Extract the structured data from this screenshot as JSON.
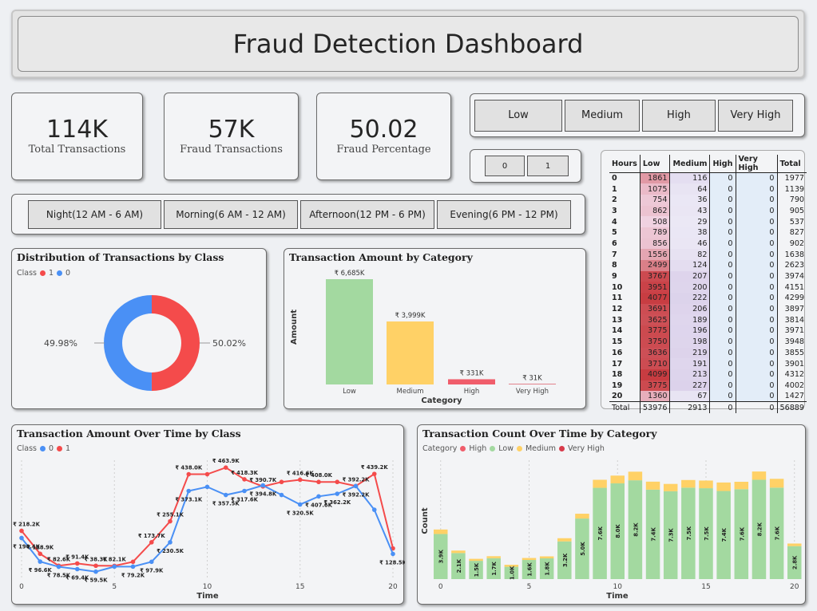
{
  "title": "Fraud Detection Dashboard",
  "kpis": [
    {
      "value": "114K",
      "label": "Total Transactions"
    },
    {
      "value": "57K",
      "label": "Fraud Transactions"
    },
    {
      "value": "50.02",
      "label": "Fraud Percentage"
    }
  ],
  "category_slicer": [
    "Low",
    "Medium",
    "High",
    "Very High"
  ],
  "class_slicer": [
    "0",
    "1"
  ],
  "time_slicer": [
    "Night(12 AM - 6 AM)",
    "Morning(6 AM - 12 AM)",
    "Afternoon(12 PM - 6 PM)",
    "Evening(6 PM - 12 PM)"
  ],
  "colors": {
    "class1": "#f44b4b",
    "class0": "#4a90f5",
    "low": "#a3d9a0",
    "medium": "#ffd166",
    "high": "#f05d6b",
    "very_high": "#d83a4a"
  },
  "donut": {
    "title": "Distribution of Transactions by Class",
    "legend_title": "Class",
    "legend": [
      "1",
      "0"
    ],
    "label_left": "49.98%",
    "label_right": "50.02%"
  },
  "bar_panel": {
    "title": "Transaction Amount by Category",
    "xlabel": "Category",
    "ylabel": "Amount"
  },
  "amount_panel": {
    "title": "Transaction Amount Over Time by Class",
    "legend_title": "Class",
    "legend": [
      "0",
      "1"
    ],
    "xlabel": "Time"
  },
  "count_panel": {
    "title": "Transaction Count Over Time by Category",
    "legend_title": "Category",
    "legend": [
      "High",
      "Low",
      "Medium",
      "Very High"
    ],
    "xlabel": "Time",
    "ylabel": "Count"
  },
  "matrix": {
    "headers": [
      "Hours",
      "Low",
      "Medium",
      "High",
      "Very High",
      "Total"
    ],
    "rows": [
      [
        "0",
        "1861",
        "116",
        "0",
        "0",
        "1977"
      ],
      [
        "1",
        "1075",
        "64",
        "0",
        "0",
        "1139"
      ],
      [
        "2",
        "754",
        "36",
        "0",
        "0",
        "790"
      ],
      [
        "3",
        "862",
        "43",
        "0",
        "0",
        "905"
      ],
      [
        "4",
        "508",
        "29",
        "0",
        "0",
        "537"
      ],
      [
        "5",
        "789",
        "38",
        "0",
        "0",
        "827"
      ],
      [
        "6",
        "856",
        "46",
        "0",
        "0",
        "902"
      ],
      [
        "7",
        "1556",
        "82",
        "0",
        "0",
        "1638"
      ],
      [
        "8",
        "2499",
        "124",
        "0",
        "0",
        "2623"
      ],
      [
        "9",
        "3767",
        "207",
        "0",
        "0",
        "3974"
      ],
      [
        "10",
        "3951",
        "200",
        "0",
        "0",
        "4151"
      ],
      [
        "11",
        "4077",
        "222",
        "0",
        "0",
        "4299"
      ],
      [
        "12",
        "3691",
        "206",
        "0",
        "0",
        "3897"
      ],
      [
        "13",
        "3625",
        "189",
        "0",
        "0",
        "3814"
      ],
      [
        "14",
        "3775",
        "196",
        "0",
        "0",
        "3971"
      ],
      [
        "15",
        "3750",
        "198",
        "0",
        "0",
        "3948"
      ],
      [
        "16",
        "3636",
        "219",
        "0",
        "0",
        "3855"
      ],
      [
        "17",
        "3710",
        "191",
        "0",
        "0",
        "3901"
      ],
      [
        "18",
        "4099",
        "213",
        "0",
        "0",
        "4312"
      ],
      [
        "19",
        "3775",
        "227",
        "0",
        "0",
        "4002"
      ],
      [
        "20",
        "1360",
        "67",
        "0",
        "0",
        "1427"
      ]
    ],
    "total": [
      "Total",
      "53976",
      "2913",
      "0",
      "0",
      "56889"
    ]
  },
  "chart_data": [
    {
      "type": "pie",
      "title": "Distribution of Transactions by Class",
      "categories": [
        "1",
        "0"
      ],
      "values": [
        50.02,
        49.98
      ],
      "data_labels": [
        "50.02%",
        "49.98%"
      ]
    },
    {
      "type": "bar",
      "title": "Transaction Amount by Category",
      "xlabel": "Category",
      "ylabel": "Amount",
      "categories": [
        "Low",
        "Medium",
        "High",
        "Very High"
      ],
      "values": [
        6685,
        3999,
        331,
        31
      ],
      "data_labels": [
        "₹ 6,685K",
        "₹ 3,999K",
        "₹ 331K",
        "₹ 31K"
      ]
    },
    {
      "type": "line",
      "title": "Transaction Amount Over Time by Class",
      "xlabel": "Time",
      "x_ticks": [
        "0",
        "5",
        "10",
        "15",
        "20"
      ],
      "x": [
        0,
        1,
        2,
        3,
        4,
        5,
        6,
        7,
        8,
        9,
        10,
        11,
        12,
        13,
        14,
        15,
        16,
        17,
        18,
        19,
        20
      ],
      "series": [
        {
          "name": "0",
          "values": [
            190.4,
            98.6,
            78.5,
            69.4,
            59.5,
            79.2,
            79.2,
            97.9,
            173.7,
            373.1,
            389.0,
            357.5,
            373.1,
            394.8,
            357.5,
            320.5,
            352.0,
            362.2,
            392.2,
            300.0,
            128.5
          ],
          "labels": [
            "₹ 190.4K",
            "₹ 96.6K",
            "₹ 78.5K",
            "₹ 69.4K",
            "₹ 59.5K",
            "",
            "₹ 79.2K",
            "₹ 97.9K",
            "₹ 230.5K",
            "₹ 373.1K",
            "",
            "₹ 357.5K",
            "₹ 317.6K",
            "₹ 394.8K",
            "",
            "₹ 320.5K",
            "₹ 407.6K",
            "₹ 362.2K",
            "₹ 392.2K",
            "",
            "₹ 128.5K"
          ]
        },
        {
          "name": "1",
          "values": [
            218.2,
            128.9,
            82.6,
            91.4,
            82.6,
            82.1,
            97.9,
            173.7,
            255.1,
            438.0,
            438.0,
            463.9,
            418.3,
            390.7,
            408.0,
            416.6,
            408.0,
            408.0,
            392.2,
            439.2,
            150.0
          ],
          "labels": [
            "₹ 218.2K",
            "₹ 128.9K",
            "₹ 82.6K",
            "₹ 91.4K",
            "₹ 38.3K",
            "₹ 82.1K",
            "",
            "₹ 173.7K",
            "₹ 255.1K",
            "₹ 438.0K",
            "",
            "₹ 463.9K",
            "₹ 418.3K",
            "₹ 390.7K",
            "",
            "₹ 416.6K",
            "₹ 408.0K",
            "",
            "₹ 392.2K",
            "₹ 439.2K",
            ""
          ]
        }
      ]
    },
    {
      "type": "bar",
      "stacked": true,
      "title": "Transaction Count Over Time by Category",
      "xlabel": "Time",
      "ylabel": "Count",
      "x_ticks": [
        "0",
        "5",
        "10",
        "15",
        "20"
      ],
      "x": [
        0,
        1,
        2,
        3,
        4,
        5,
        6,
        7,
        8,
        9,
        10,
        11,
        12,
        13,
        14,
        15,
        16,
        17,
        18,
        19,
        20
      ],
      "series": [
        {
          "name": "Low",
          "values": [
            1861,
            1075,
            754,
            862,
            508,
            789,
            856,
            1556,
            2499,
            3767,
            3951,
            4077,
            3691,
            3625,
            3775,
            3750,
            3636,
            3710,
            4099,
            3775,
            1360
          ],
          "labels": [
            "3.9K",
            "2.1K",
            "1.5K",
            "1.7K",
            "1.0K",
            "1.6K",
            "1.8K",
            "3.2K",
            "5.0K",
            "7.6K",
            "8.0K",
            "8.2K",
            "7.4K",
            "7.3K",
            "7.5K",
            "7.5K",
            "7.4K",
            "7.6K",
            "8.2K",
            "7.6K",
            "2.8K"
          ]
        },
        {
          "name": "Medium",
          "values": [
            116,
            64,
            36,
            43,
            29,
            38,
            46,
            82,
            124,
            207,
            200,
            222,
            206,
            189,
            196,
            198,
            219,
            191,
            213,
            227,
            67
          ]
        },
        {
          "name": "High",
          "values": [
            0,
            0,
            0,
            0,
            0,
            0,
            0,
            0,
            0,
            0,
            0,
            0,
            0,
            0,
            0,
            0,
            0,
            0,
            0,
            0,
            0
          ]
        },
        {
          "name": "Very High",
          "values": [
            0,
            0,
            0,
            0,
            0,
            0,
            0,
            0,
            0,
            0,
            0,
            0,
            0,
            0,
            0,
            0,
            0,
            0,
            0,
            0,
            0
          ]
        }
      ]
    }
  ]
}
